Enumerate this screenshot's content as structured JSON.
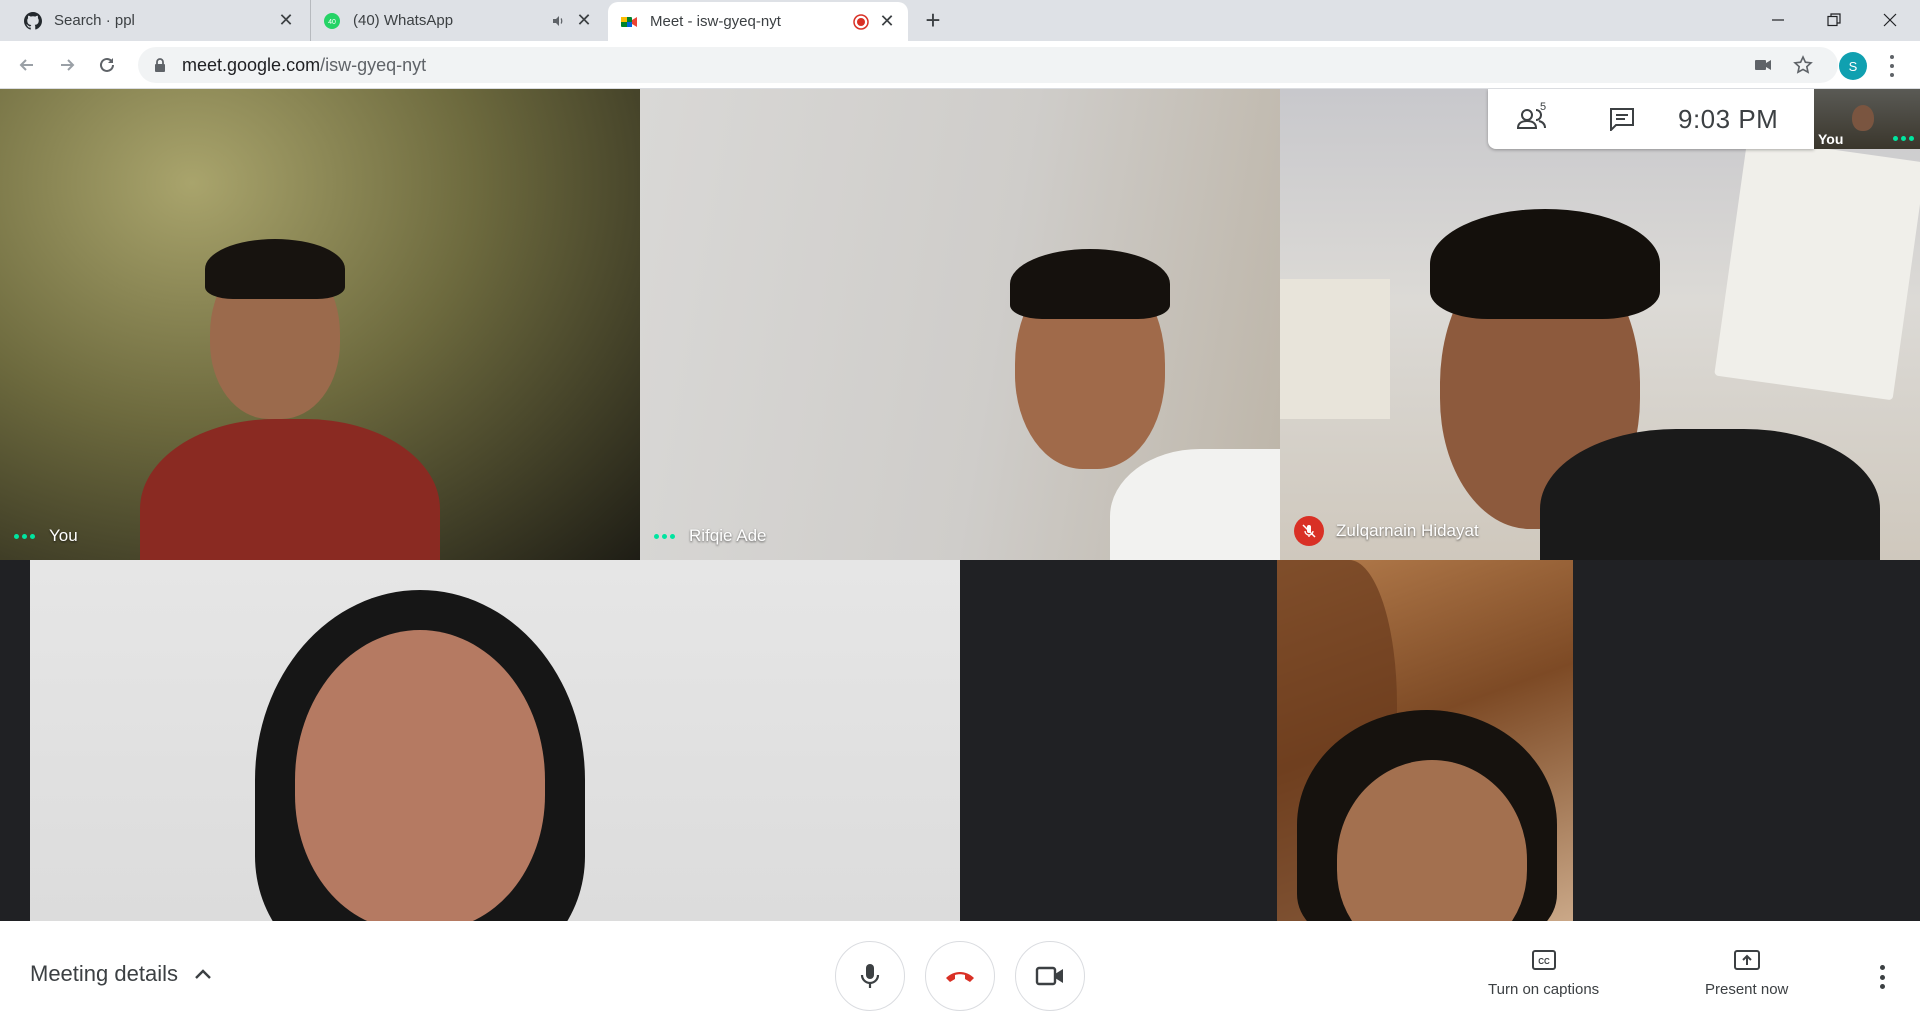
{
  "browser": {
    "tabs": [
      {
        "title": "Search · ppl",
        "icon": "github-icon"
      },
      {
        "title": "(40) WhatsApp",
        "icon": "whatsapp-icon",
        "badge": "40"
      },
      {
        "title": "Meet - isw-gyeq-nyt",
        "icon": "google-meet-icon",
        "active": true
      }
    ],
    "url_host": "meet.google.com",
    "url_path": "/isw-gyeq-nyt",
    "profile_initial": "S"
  },
  "meet": {
    "participants": [
      {
        "name": "You",
        "status": "speaking-dots"
      },
      {
        "name": "Rifqie Ade",
        "status": "speaking-dots"
      },
      {
        "name": "Zulqarnain Hidayat",
        "status": "muted"
      },
      {
        "name": "",
        "status": ""
      },
      {
        "name": "",
        "status": ""
      }
    ],
    "people_count": "5",
    "time": "9:03  PM",
    "self_view_label": "You",
    "colors": {
      "accent_green": "#00e5a0",
      "hangup_red": "#d93025",
      "profile_teal": "#10a0b0"
    }
  },
  "controls": {
    "meeting_details": "Meeting details",
    "captions": "Turn on captions",
    "present": "Present now"
  }
}
